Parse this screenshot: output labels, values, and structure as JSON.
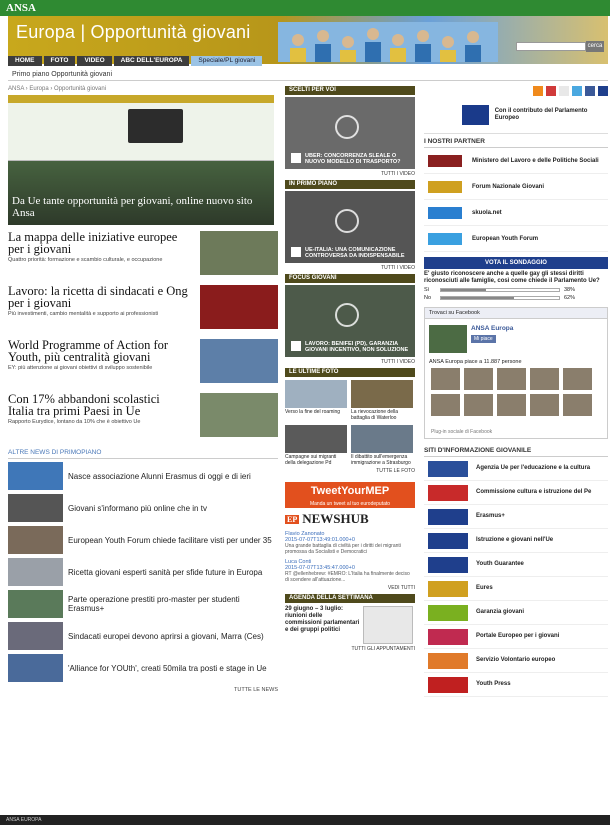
{
  "topbar": {
    "logo": "ANSA",
    "right": ""
  },
  "banner": {
    "title_a": "Europa",
    "title_b": "Opportunità giovani",
    "sub": "",
    "search_btn": "cerca"
  },
  "nav": [
    "HOME",
    "FOTO",
    "VIDEO",
    "ABC DELL'EUROPA",
    "Speciale/PL giovani"
  ],
  "crumbbar": "Primo piano Opportunità giovani",
  "breadcrumb": "ANSA › Europa › Opportunità giovani",
  "hero": {
    "caption": "Da Ue tante opportunità per giovani, online nuovo sito Ansa",
    "sub": ""
  },
  "stories": [
    {
      "title": "La mappa delle iniziative europee per i giovani",
      "desc": "Quattro priorità: formazione e scambio culturale, e occupazione",
      "color": "#6d7a5a"
    },
    {
      "title": "Lavoro: la ricetta di sindacati e Ong per i giovani",
      "desc": "Più investimenti, cambio mentalità e supporto ai professionisti",
      "color": "#8a1c1c"
    },
    {
      "title": "World Programme of Action for Youth, più centralità giovani",
      "desc": "EY: più attenzione ai giovani obiettivi di sviluppo sostenibile",
      "color": "#5d7fa8"
    },
    {
      "title": "Con 17% abbandoni scolastici Italia tra primi Paesi in Ue",
      "desc": "Rapporto Eurydice, lontano da 10% che è obiettivo Ue",
      "color": "#7a8a6a"
    }
  ],
  "altre": "ALTRE NEWS DI PRIMOPIANO",
  "news": [
    {
      "t": "Nasce associazione Alunni Erasmus di oggi e di ieri",
      "c": "#3f77b8"
    },
    {
      "t": "Giovani s'informano più online che in tv",
      "c": "#555"
    },
    {
      "t": "European Youth Forum chiede facilitare visti per under 35",
      "c": "#7a6a5a"
    },
    {
      "t": "Ricetta giovani esperti sanità per sfide future in Europa",
      "c": "#9aa0a8"
    },
    {
      "t": "Parte operazione prestiti pro-master per studenti Erasmus+",
      "c": "#5a7a5a"
    },
    {
      "t": "Sindacati europei devono aprirsi a giovani, Marra (Ces)",
      "c": "#6a6a7a"
    },
    {
      "t": "'Alliance for YOUth', creati 50mila tra posti e stage in Ue",
      "c": "#4a6a9a"
    }
  ],
  "tutte_news": "TUTTE LE NEWS",
  "col2": {
    "scelti": "SCELTI PER VOI",
    "scelti_vid": "UBER: CONCORRENZA SLEALE O NUOVO MODELLO DI TRASPORTO?",
    "tutti_video": "TUTTI I VIDEO",
    "primo": "IN PRIMO PIANO",
    "primo_vid": "UE-ITALIA: UNA COMUNICAZIONE CONTROVERSA DA INDISPENSABILE",
    "focus": "FOCUS GIOVANI",
    "focus_vid": "LAVORO: BENIFEI (PD), GARANZIA GIOVANI INCENTIVO, NON SOLUZIONE",
    "foto_head": "LE ULTIME FOTO",
    "foto": [
      {
        "c": "Verso la fine del roaming",
        "col": "#9fb0c0"
      },
      {
        "c": "La rievocazione della battaglia di Waterloo",
        "col": "#7a6a4a"
      },
      {
        "c": "Campagne sui migranti della delegazione Pd",
        "col": "#5a5a5a"
      },
      {
        "c": "Il dibattito sull'emergenza immigrazione a Strasburgo",
        "col": "#6a7a8a"
      }
    ],
    "tutte_foto": "TUTTE LE FOTO",
    "tweet": "TweetYourMEP",
    "tweet_sub": "Manda un tweet al tuo eurodeputato",
    "newshub": "NEWSHUB",
    "tw1_who": "Flavio Zanonato",
    "tw1_date": "2015-07-07T13:49:01.000+0",
    "tw1_txt": "Una grande battaglia di civiltà per i diritti dei migranti promossa da Socialisti e Democratici",
    "tw2_who": "Luca Conti",
    "tw2_date": "2015-07-07T13:45:47.000+0",
    "tw2_txt": "RT @ellenhebrew: #EMRO: L'Italia ha finalmente deciso di scendere all'attuazione...",
    "vedi": "VEDI TUTTI",
    "agenda": "AGENDA DELLA SETTIMANA",
    "agenda_txt": "29 giugno – 3 luglio: riunioni delle commissioni parlamentari e dei gruppi politici",
    "tutti_app": "TUTTI GLI APPUNTAMENTI"
  },
  "col3": {
    "ep": "Con il contributo del Parlamento Europeo",
    "partners_head": "I NOSTRI PARTNER",
    "partners": [
      {
        "n": "Ministero del Lavoro e delle Politiche Sociali",
        "c": "#8a2020"
      },
      {
        "n": "Forum Nazionale Giovani",
        "c": "#cfa020"
      },
      {
        "n": "skuola.net",
        "c": "#2a7fd0"
      },
      {
        "n": "European Youth Forum",
        "c": "#3aa0e0"
      }
    ],
    "vota": "VOTA IL SONDAGGIO",
    "question": "E' giusto riconoscere anche a quelle gay gli stessi diritti riconosciuti alle famiglie, così come chiede il Parlamento Ue?",
    "si": "Sì",
    "si_pct": "38%",
    "si_val": 38,
    "no": "No",
    "no_pct": "62%",
    "no_val": 62,
    "fb_head": "Trovaci su Facebook",
    "fb_name": "ANSA Europa",
    "fb_like": "Mi piace",
    "fb_count": "ANSA Europa piace a 11.887 persone",
    "fb_plugin": "Plug-in sociale di Facebook",
    "siti_head": "SITI D'INFORMAZIONE GIOVANILE",
    "siti": [
      {
        "n": "Agenzia Ue per l'educazione e la cultura",
        "c": "#2a4f9a"
      },
      {
        "n": "Commissione cultura e istruzione del Pe",
        "c": "#c82a2a"
      },
      {
        "n": "Erasmus+",
        "c": "#1f3f8c"
      },
      {
        "n": "Istruzione e giovani nell'Ue",
        "c": "#1f3f8c"
      },
      {
        "n": "Youth Guarantee",
        "c": "#1f3f8c"
      },
      {
        "n": "Eures",
        "c": "#d0a020"
      },
      {
        "n": "Garanzia giovani",
        "c": "#7ab020"
      },
      {
        "n": "Portale Europeo per i giovani",
        "c": "#c02a50"
      },
      {
        "n": "Servizio Volontario europeo",
        "c": "#e07a2a"
      },
      {
        "n": "Youth Press",
        "c": "#c02020"
      }
    ]
  },
  "footer": "ANSA EUROPA"
}
